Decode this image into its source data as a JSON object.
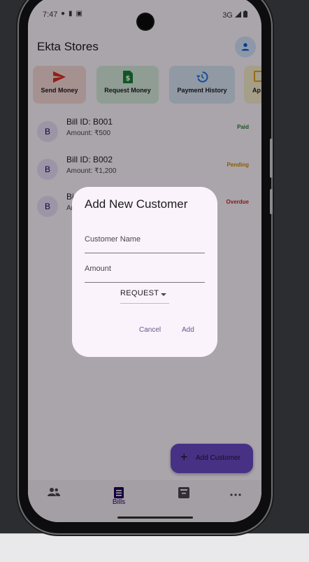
{
  "status_bar": {
    "time": "7:47",
    "network": "3G"
  },
  "app": {
    "title": "Ekta Stores"
  },
  "colors": {
    "send_accent": "#d93025",
    "request_accent": "#188038",
    "history_accent": "#1a73e8",
    "approve_accent": "#e3a21a",
    "paid": "#2e7d32",
    "pending": "#d08a00",
    "overdue": "#c62828"
  },
  "actions": [
    {
      "label": "Send Money",
      "icon": "send-icon"
    },
    {
      "label": "Request Money",
      "icon": "dollar-document-icon"
    },
    {
      "label": "Payment History",
      "icon": "history-icon"
    },
    {
      "label": "Ap",
      "icon": "approve-icon"
    }
  ],
  "bills": [
    {
      "avatar": "B",
      "id": "Bill ID: B001",
      "amount": "Amount: ₹500",
      "status": "Paid"
    },
    {
      "avatar": "B",
      "id": "Bill ID: B002",
      "amount": "Amount: ₹1,200",
      "status": "Pending"
    },
    {
      "avatar": "B",
      "id": "Bi",
      "amount": "Ar",
      "status": "Overdue"
    }
  ],
  "fab": {
    "label": "Add Customer",
    "icon": "plus-icon"
  },
  "bottom_nav": [
    {
      "label": "",
      "icon": "people-icon"
    },
    {
      "label": "Bills",
      "icon": "receipt-icon"
    },
    {
      "label": "",
      "icon": "archive-icon"
    },
    {
      "label": "",
      "icon": "more-horizontal-icon"
    }
  ],
  "dialog": {
    "title": "Add New Customer",
    "customer_name_placeholder": "Customer Name",
    "amount_placeholder": "Amount",
    "type_value": "REQUEST",
    "cancel_label": "Cancel",
    "add_label": "Add"
  }
}
